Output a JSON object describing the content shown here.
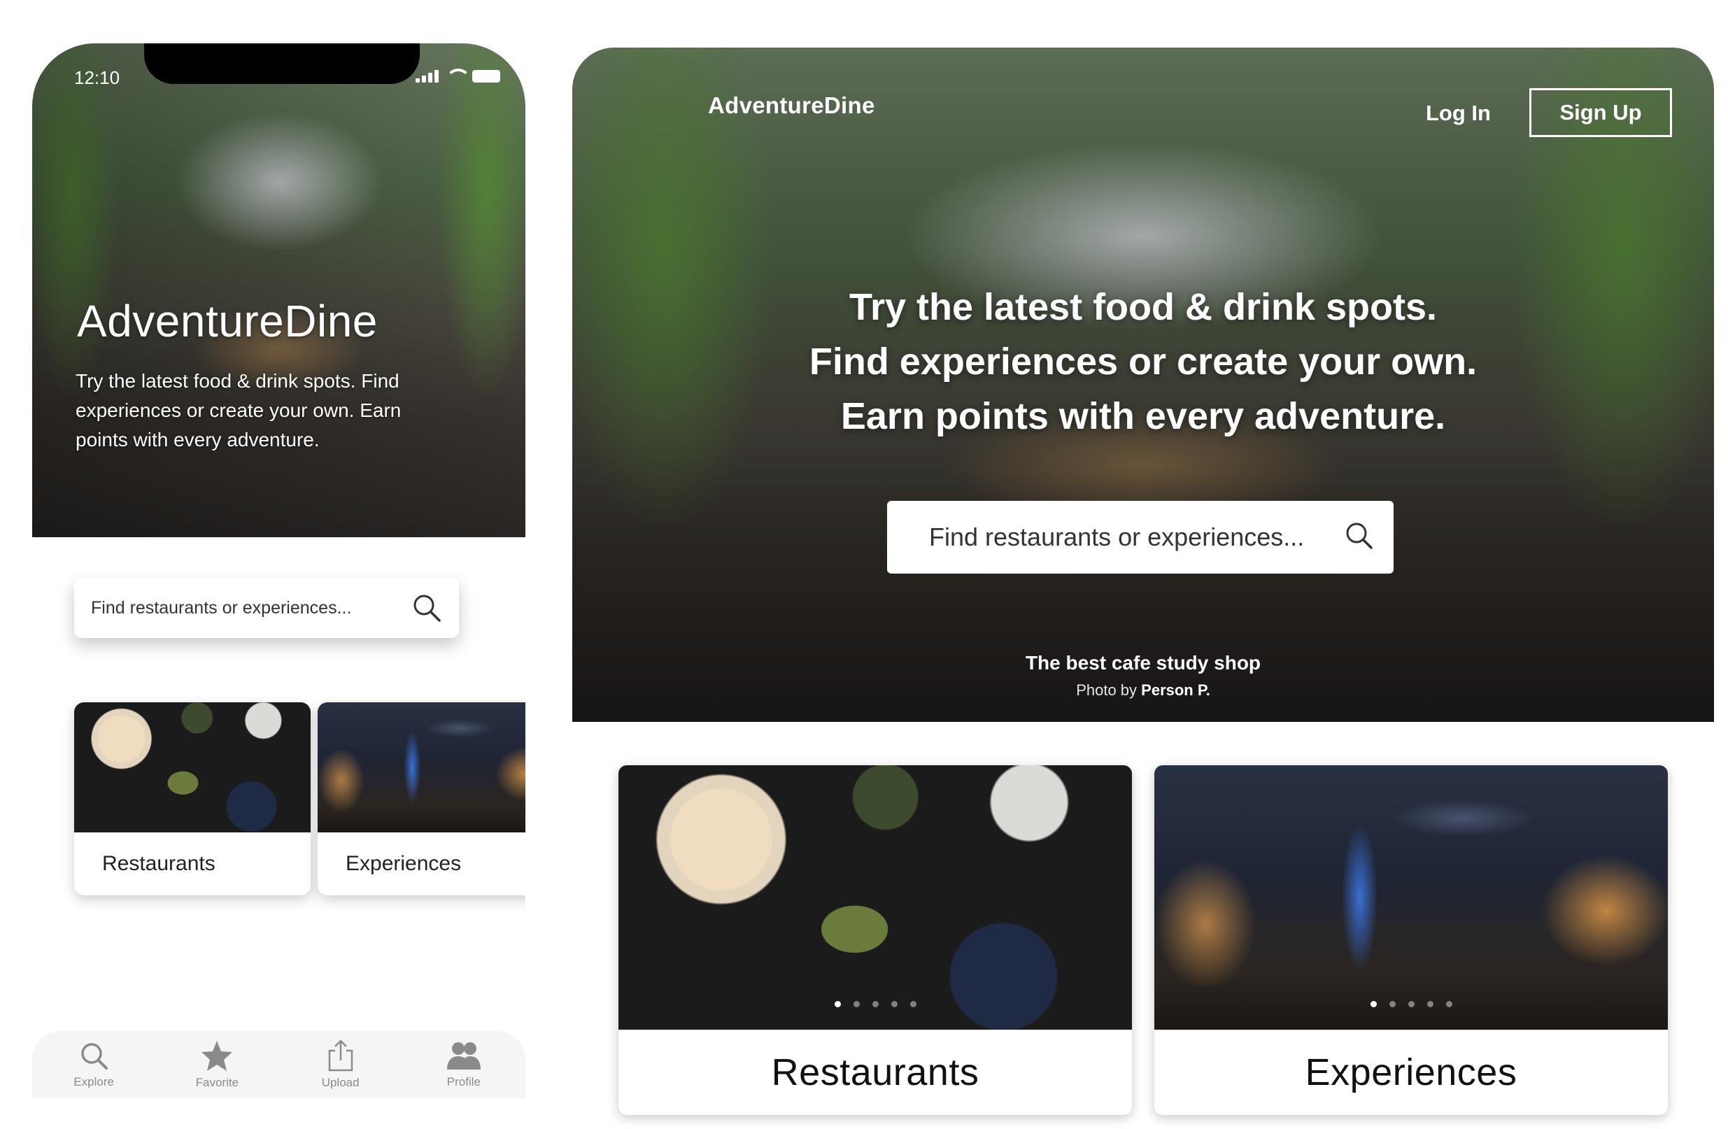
{
  "mobile": {
    "status_time": "12:10",
    "brand": "AdventureDine",
    "tagline": "Try the latest food & drink spots. Find experiences or create your own. Earn points with every adventure.",
    "search_placeholder": "Find restaurants or experiences...",
    "cards": [
      {
        "label": "Restaurants"
      },
      {
        "label": "Experiences"
      }
    ],
    "tabs": [
      {
        "label": "Explore",
        "icon": "search-icon"
      },
      {
        "label": "Favorite",
        "icon": "star-icon"
      },
      {
        "label": "Upload",
        "icon": "share-icon"
      },
      {
        "label": "Profile",
        "icon": "people-icon"
      }
    ]
  },
  "desktop": {
    "brand": "AdventureDine",
    "login_label": "Log In",
    "signup_label": "Sign Up",
    "headline_lines": [
      "Try the latest food & drink spots.",
      "Find experiences or create your own.",
      "Earn points with every adventure."
    ],
    "search_placeholder": "Find restaurants or experiences...",
    "photo_title": "The best cafe study shop",
    "photo_credit_prefix": "Photo by",
    "photo_credit_name": "Person P.",
    "cards": [
      {
        "label": "Restaurants"
      },
      {
        "label": "Experiences"
      }
    ]
  },
  "colors": {
    "tab_inactive": "#8a8a8a",
    "card_text": "#111111"
  }
}
